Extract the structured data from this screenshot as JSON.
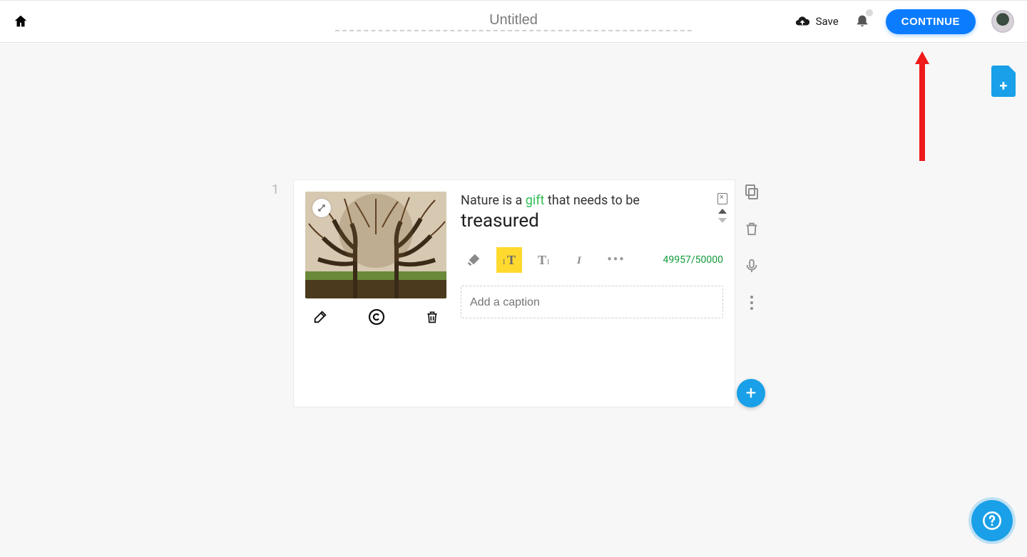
{
  "header": {
    "title": "Untitled",
    "save_label": "Save",
    "continue_label": "CONTINUE"
  },
  "page": {
    "number": "1"
  },
  "block": {
    "text_prefix": "Nature is a ",
    "text_highlight": "gift",
    "text_suffix": " that needs to be",
    "text_big": "treasured",
    "char_count": "49957/50000",
    "caption_placeholder": "Add a caption"
  },
  "icons": {
    "home": "home-icon",
    "cloud_upload": "cloud-upload-icon",
    "bell": "bell-icon",
    "avatar": "avatar",
    "add_page": "add-page-icon",
    "expand": "expand-icon",
    "edit": "edit-icon",
    "copyright": "copyright-icon",
    "trash": "trash-icon",
    "format_highlight": "highlight-icon",
    "format_size_small": "text-size-small-icon",
    "format_size_large": "text-size-large-icon",
    "format_italic": "italic-icon",
    "format_more": "more-icon",
    "copy": "copy-icon",
    "side_trash": "trash-icon",
    "mic": "mic-icon",
    "kebab": "kebab-icon",
    "fab_plus": "plus-icon",
    "help": "help-icon",
    "move_up": "move-up-icon",
    "move_down": "move-down-icon",
    "delete_text": "delete-text-icon"
  },
  "colors": {
    "accent_blue": "#0c7cff",
    "brand_cyan": "#19a0e8",
    "highlight_yellow": "#ffd92e",
    "gift_green": "#2fbf55",
    "count_green": "#139a3a",
    "arrow_red": "#ef1b1b"
  }
}
